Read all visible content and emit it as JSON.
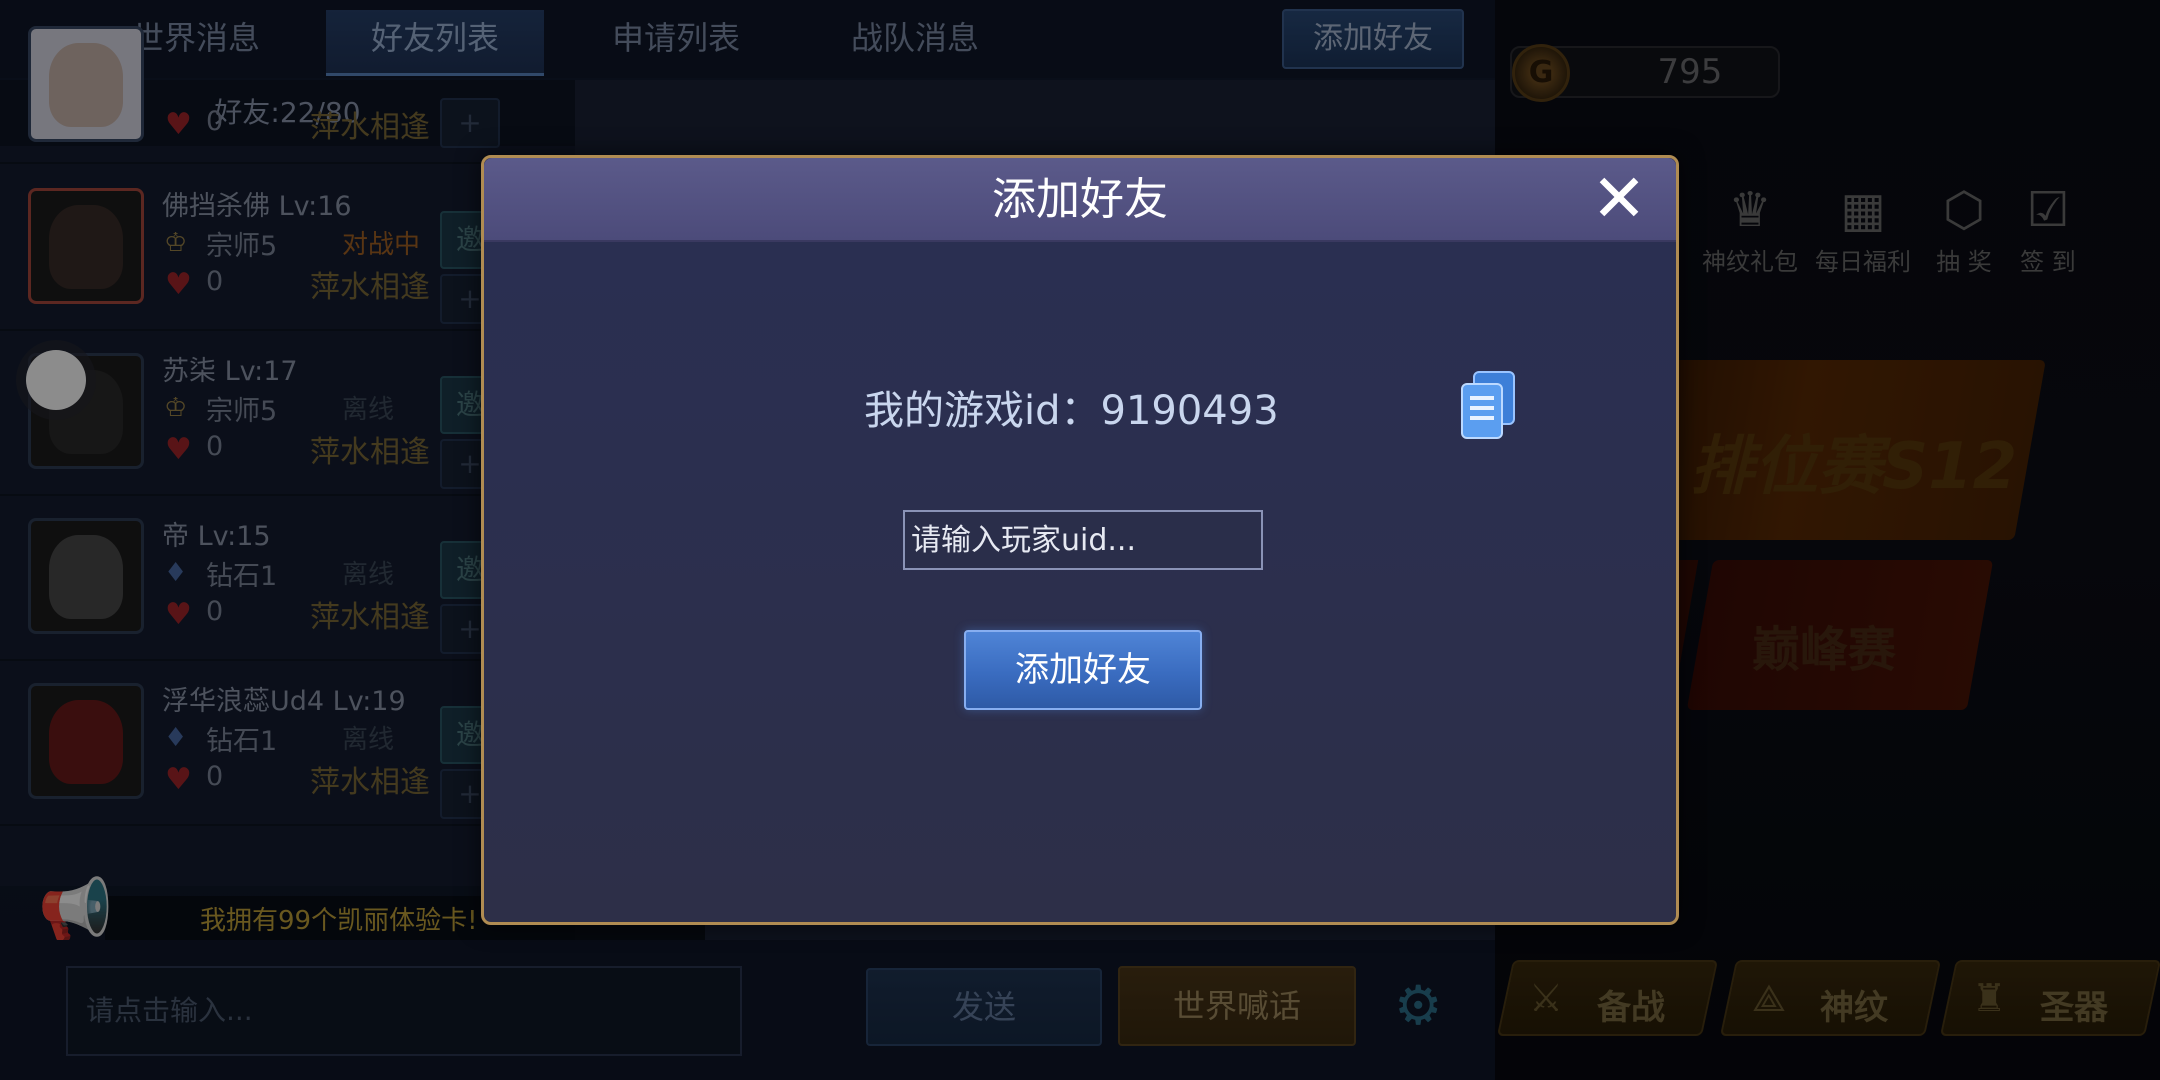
{
  "tabs": [
    {
      "label": "世界消息"
    },
    {
      "label": "好友列表",
      "active": true
    },
    {
      "label": "申请列表"
    },
    {
      "label": "战队消息"
    }
  ],
  "top_add_friend_label": "添加好友",
  "friend_count": "好友:22/80",
  "friends": [
    {
      "name": "",
      "rank": "",
      "status": "",
      "hearts": "0",
      "motto": "萍水相逢",
      "invite": ""
    },
    {
      "name": "佛挡杀佛 Lv:16",
      "rank": "宗师5",
      "status": "对战中",
      "hearts": "0",
      "motto": "萍水相逢",
      "invite": "邀请"
    },
    {
      "name": "苏柒 Lv:17",
      "rank": "宗师5",
      "status": "离线",
      "hearts": "0",
      "motto": "萍水相逢",
      "invite": "邀请"
    },
    {
      "name": "帝 Lv:15",
      "rank": "钻石1",
      "status": "离线",
      "hearts": "0",
      "motto": "萍水相逢",
      "invite": "邀请"
    },
    {
      "name": "浮华浪蕊Ud4 Lv:19",
      "rank": "钻石1",
      "status": "离线",
      "hearts": "0",
      "motto": "萍水相逢",
      "invite": "邀请"
    }
  ],
  "announcement": "我拥有99个凯丽体验卡!",
  "chat": {
    "placeholder": "请点击输入...",
    "send_label": "发送",
    "shout_label": "世界喊话"
  },
  "coins": "795",
  "coin_glyph": "G",
  "top_icons": [
    {
      "label": "神纹礼包",
      "icon": "crown-icon"
    },
    {
      "label": "每日福利",
      "icon": "gift-icon"
    },
    {
      "label": "抽 奖",
      "icon": "lottery-icon"
    },
    {
      "label": "签 到",
      "icon": "checkin-icon"
    }
  ],
  "promos": {
    "ranked": "排位赛S12",
    "peak": "巅峰赛"
  },
  "bottom_buttons": [
    {
      "label": "备战",
      "icon": "swords-icon"
    },
    {
      "label": "神纹",
      "icon": "rune-icon"
    },
    {
      "label": "圣器",
      "icon": "trophy-icon"
    }
  ],
  "modal": {
    "title": "添加好友",
    "close_glyph": "✕",
    "id_label": "我的游戏id：9190493",
    "uid_placeholder": "请输入玩家uid...",
    "add_button_label": "添加好友"
  },
  "colors": {
    "modal_border": "#b08c52",
    "modal_header": "#4c4b7a",
    "add_button": "#3a6cc0",
    "battle_status": "#a36224",
    "offline_status": "#3d4a5a"
  }
}
